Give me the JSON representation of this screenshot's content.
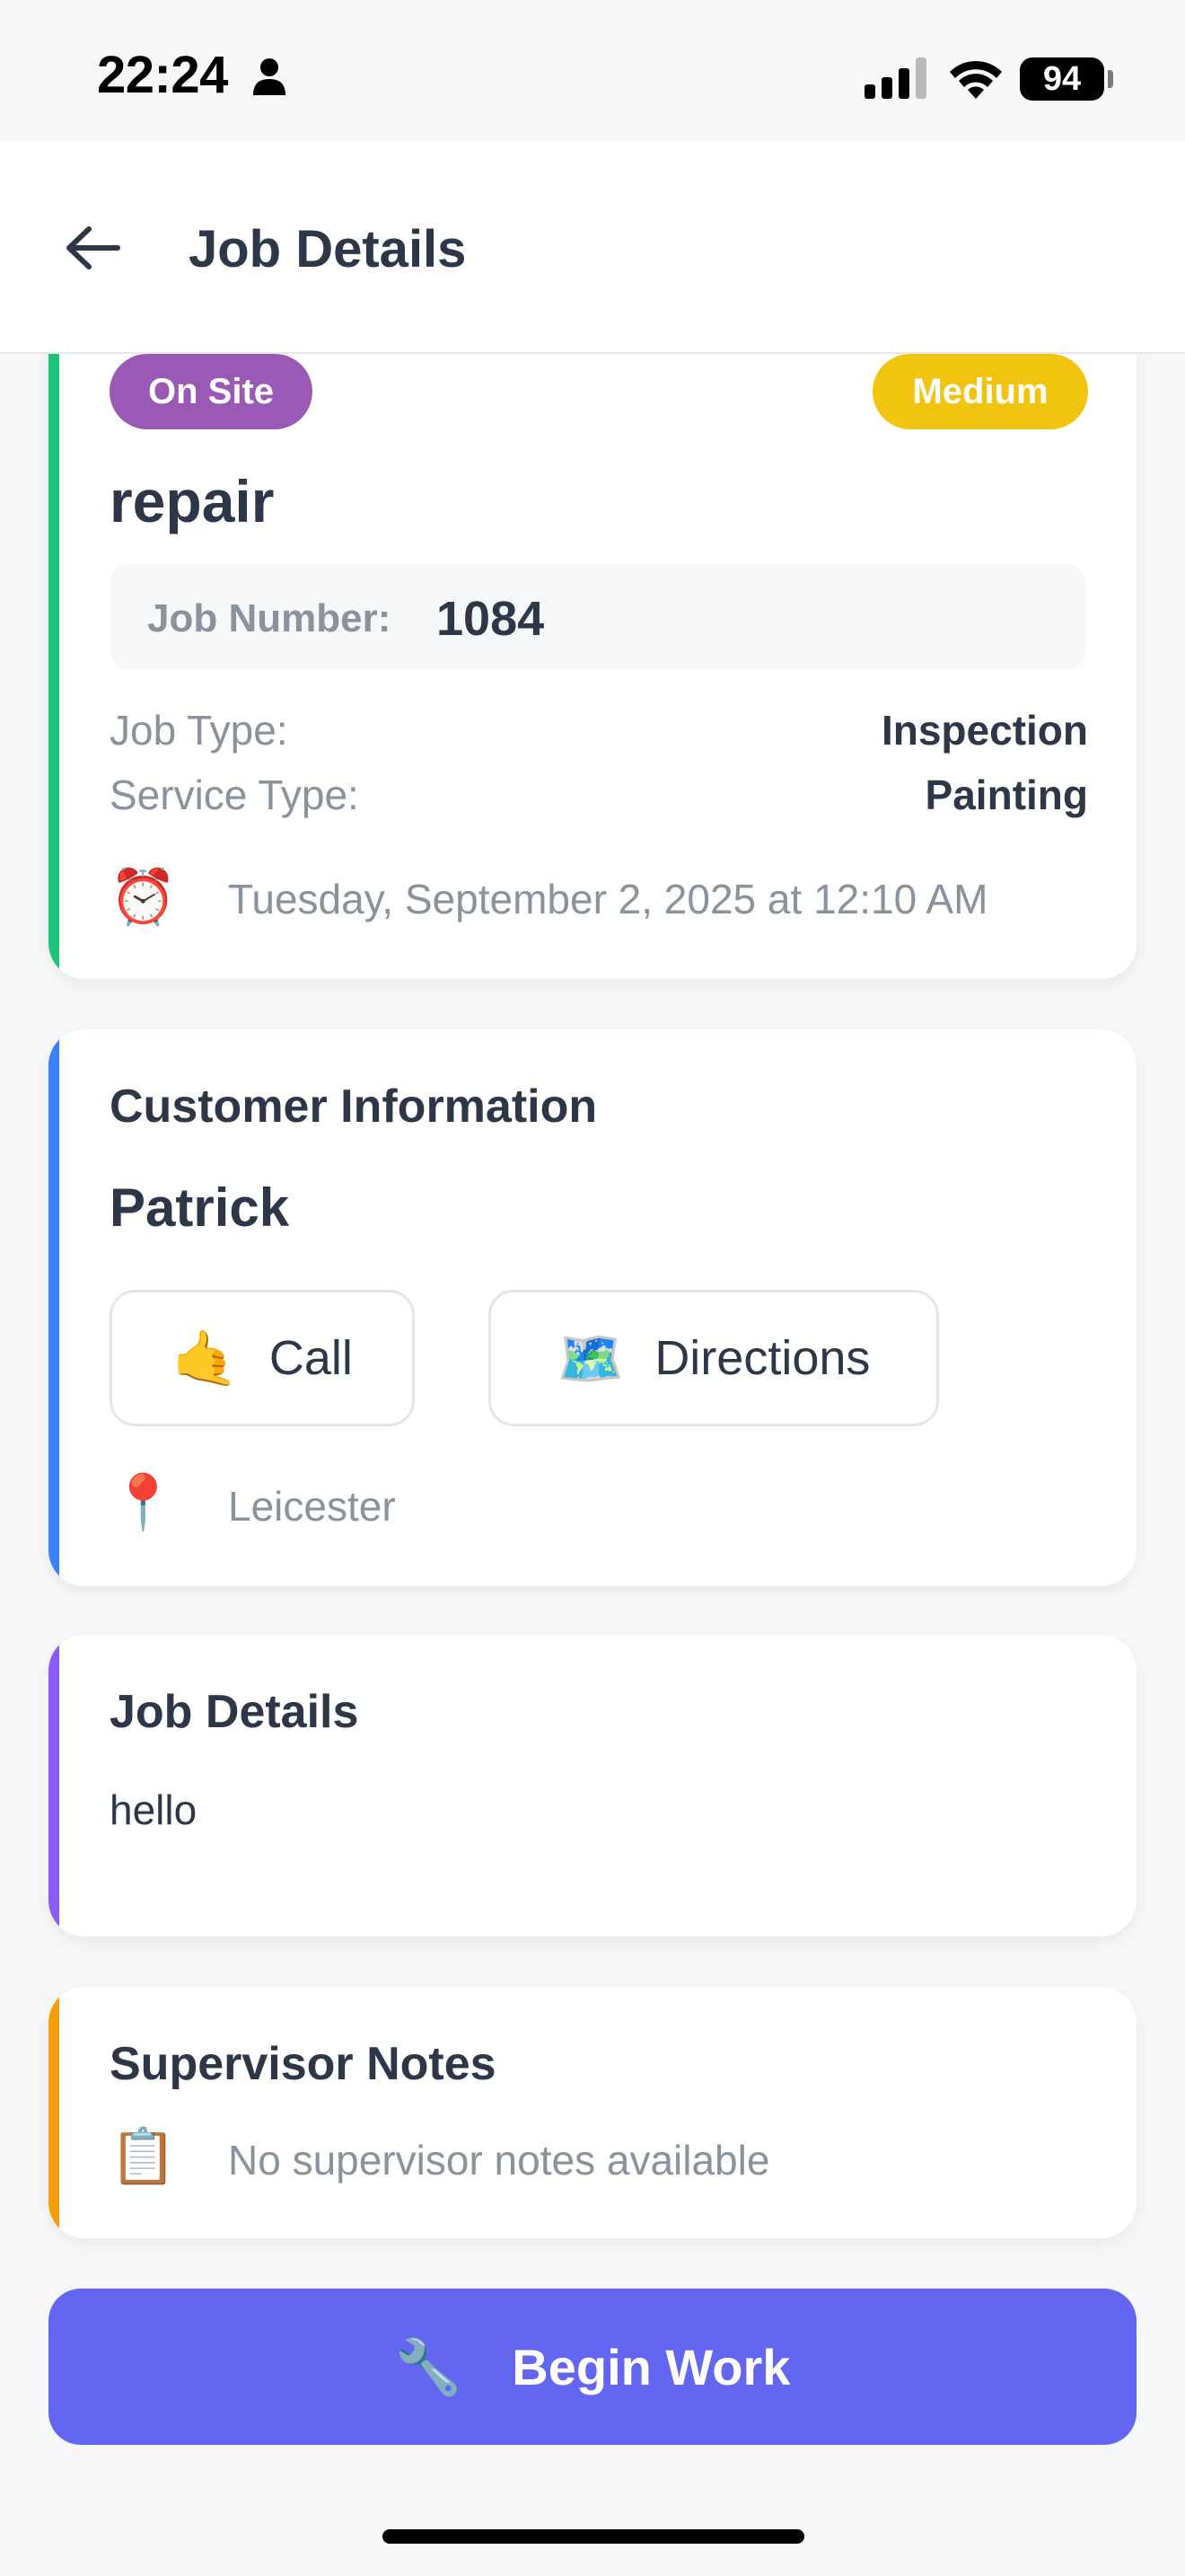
{
  "status_bar": {
    "time": "22:24",
    "battery": "94"
  },
  "header": {
    "title": "Job Details",
    "back_icon": "arrow-left-icon"
  },
  "job_card": {
    "accent_color": "#22c17a",
    "status_badge": {
      "label": "On Site",
      "color": "#9b59b6"
    },
    "priority_badge": {
      "label": "Medium",
      "color": "#f1c40f"
    },
    "title": "repair",
    "job_number_label": "Job Number:",
    "job_number": "1084",
    "job_type_label": "Job Type:",
    "job_type": "Inspection",
    "service_type_label": "Service Type:",
    "service_type": "Painting",
    "schedule_icon": "⏰",
    "schedule": "Tuesday, September 2, 2025 at 12:10 AM"
  },
  "customer_card": {
    "accent_color": "#3b82f6",
    "title": "Customer Information",
    "name": "Patrick",
    "call_icon": "🤙",
    "call_label": "Call",
    "directions_icon": "🗺️",
    "directions_label": "Directions",
    "location_icon": "📍",
    "location": "Leicester"
  },
  "details_card": {
    "accent_color": "#8b5cf6",
    "title": "Job Details",
    "text": "hello"
  },
  "notes_card": {
    "accent_color": "#f59e0b",
    "title": "Supervisor Notes",
    "icon": "📋",
    "text": "No supervisor notes available"
  },
  "primary_action": {
    "icon": "🔧",
    "label": "Begin Work",
    "color": "#6366f1"
  }
}
